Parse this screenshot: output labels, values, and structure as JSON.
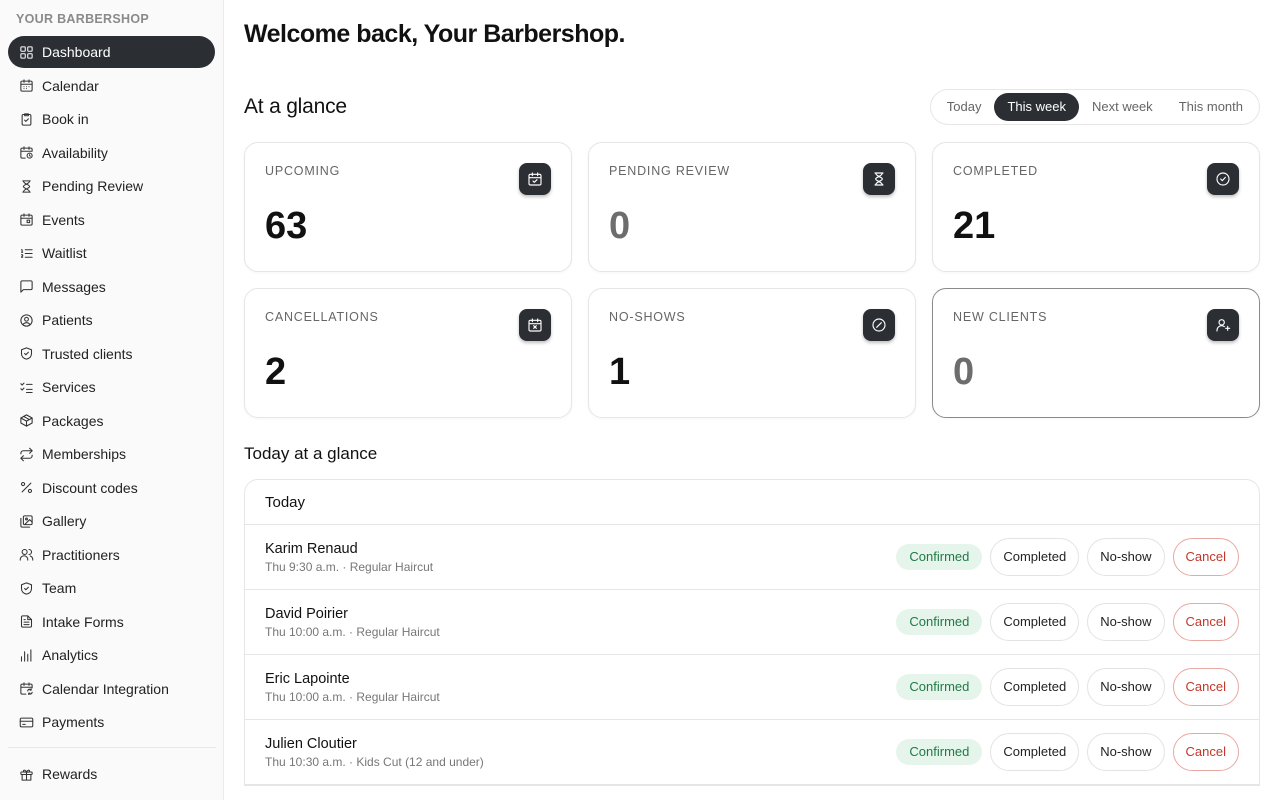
{
  "sidebar": {
    "brand": "YOUR BARBERSHOP",
    "items": [
      {
        "label": "Dashboard",
        "icon": "grid-icon",
        "active": true
      },
      {
        "label": "Calendar",
        "icon": "calendar-icon"
      },
      {
        "label": "Book in",
        "icon": "clipboard-icon"
      },
      {
        "label": "Availability",
        "icon": "calendar-clock-icon"
      },
      {
        "label": "Pending Review",
        "icon": "hourglass-icon"
      },
      {
        "label": "Events",
        "icon": "calendar-event-icon"
      },
      {
        "label": "Waitlist",
        "icon": "list-ordered-icon"
      },
      {
        "label": "Messages",
        "icon": "message-icon"
      },
      {
        "label": "Patients",
        "icon": "user-circle-icon"
      },
      {
        "label": "Trusted clients",
        "icon": "shield-check-icon"
      },
      {
        "label": "Services",
        "icon": "list-checks-icon"
      },
      {
        "label": "Packages",
        "icon": "package-icon"
      },
      {
        "label": "Memberships",
        "icon": "repeat-icon"
      },
      {
        "label": "Discount codes",
        "icon": "percent-icon"
      },
      {
        "label": "Gallery",
        "icon": "gallery-icon"
      },
      {
        "label": "Practitioners",
        "icon": "users-icon"
      },
      {
        "label": "Team",
        "icon": "shield-icon"
      },
      {
        "label": "Intake Forms",
        "icon": "file-text-icon"
      },
      {
        "label": "Analytics",
        "icon": "bar-chart-icon"
      },
      {
        "label": "Calendar Integration",
        "icon": "calendar-sync-icon"
      },
      {
        "label": "Payments",
        "icon": "credit-card-icon"
      }
    ],
    "bottom_items": [
      {
        "label": "Rewards",
        "icon": "gift-icon"
      }
    ]
  },
  "header": {
    "welcome": "Welcome back, Your Barbershop."
  },
  "glance": {
    "title": "At a glance",
    "ranges": [
      "Today",
      "This week",
      "Next week",
      "This month"
    ],
    "selected_range": "This week",
    "cards": [
      {
        "label": "UPCOMING",
        "value": "63",
        "icon": "calendar-check-icon"
      },
      {
        "label": "PENDING REVIEW",
        "value": "0",
        "icon": "hourglass-icon"
      },
      {
        "label": "COMPLETED",
        "value": "21",
        "icon": "check-circle-icon"
      },
      {
        "label": "CANCELLATIONS",
        "value": "2",
        "icon": "calendar-x-icon"
      },
      {
        "label": "NO-SHOWS",
        "value": "1",
        "icon": "ban-icon"
      },
      {
        "label": "NEW CLIENTS",
        "value": "0",
        "icon": "user-plus-icon"
      }
    ]
  },
  "today": {
    "title": "Today at a glance",
    "header": "Today",
    "appointments": [
      {
        "name": "Karim Renaud",
        "detail": "Thu 9:30 a.m. · Regular Haircut",
        "status": "Confirmed"
      },
      {
        "name": "David Poirier",
        "detail": "Thu 10:00 a.m. · Regular Haircut",
        "status": "Confirmed"
      },
      {
        "name": "Eric Lapointe",
        "detail": "Thu 10:00 a.m. · Regular Haircut",
        "status": "Confirmed"
      },
      {
        "name": "Julien Cloutier",
        "detail": "Thu 10:30 a.m. · Kids Cut (12 and under)",
        "status": "Confirmed"
      }
    ],
    "actions": {
      "completed": "Completed",
      "no_show": "No-show",
      "cancel": "Cancel"
    }
  },
  "colors": {
    "accent": "#2b2e33",
    "confirmed_bg": "#e6f5ec",
    "confirmed_text": "#217a45",
    "cancel": "#c0392b"
  }
}
